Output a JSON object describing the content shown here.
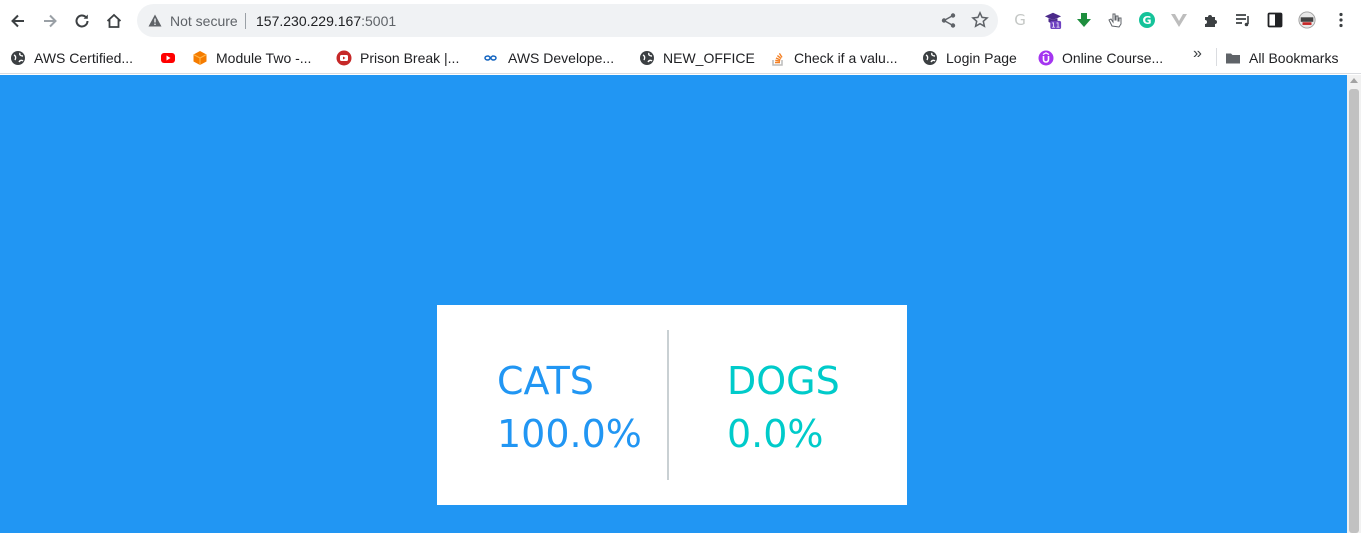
{
  "browser": {
    "security_label": "Not secure",
    "url_host": "157.230.229.167",
    "url_port": ":5001",
    "extension_badge": "11"
  },
  "bookmarks": {
    "items": [
      {
        "label": "AWS Certified...",
        "icon": "globe-icon"
      },
      {
        "label": "",
        "icon": "youtube-icon"
      },
      {
        "label": "Module Two -...",
        "icon": "cube-icon"
      },
      {
        "label": "Prison Break |...",
        "icon": "video-icon"
      },
      {
        "label": "AWS Develope...",
        "icon": "infinity-icon"
      },
      {
        "label": "NEW_OFFICE",
        "icon": "globe-icon"
      },
      {
        "label": "Check if a valu...",
        "icon": "stackoverflow-icon"
      },
      {
        "label": "Login Page",
        "icon": "globe-icon"
      },
      {
        "label": "Online Course...",
        "icon": "udemy-icon"
      }
    ],
    "more": "»",
    "all_bookmarks": "All Bookmarks"
  },
  "poll": {
    "option_a": {
      "label": "CATS",
      "percent": "100.0%"
    },
    "option_b": {
      "label": "DOGS",
      "percent": "0.0%"
    }
  },
  "colors": {
    "page_background": "#2196f3",
    "option_a": "#2196f3",
    "option_b": "#00cbca"
  }
}
